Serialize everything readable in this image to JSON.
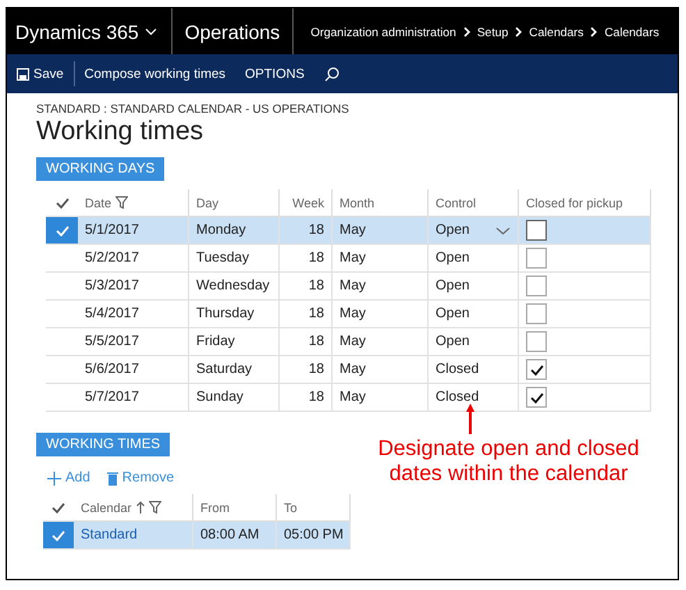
{
  "top_bar": {
    "product": "Dynamics 365",
    "module": "Operations",
    "breadcrumb": [
      "Organization administration",
      "Setup",
      "Calendars",
      "Calendars"
    ]
  },
  "toolbar": {
    "save": "Save",
    "actions": [
      "Compose working times",
      "OPTIONS"
    ]
  },
  "page": {
    "subtitle": "STANDARD : STANDARD CALENDAR - US OPERATIONS",
    "title": "Working times"
  },
  "working_days": {
    "tab": "WORKING DAYS",
    "columns": [
      "Date",
      "Day",
      "Week",
      "Month",
      "Control",
      "Closed for pickup"
    ],
    "rows": [
      {
        "date": "5/1/2017",
        "day": "Monday",
        "week": "18",
        "month": "May",
        "control": "Open",
        "closed_for_pickup": false,
        "selected": true
      },
      {
        "date": "5/2/2017",
        "day": "Tuesday",
        "week": "18",
        "month": "May",
        "control": "Open",
        "closed_for_pickup": false,
        "selected": false
      },
      {
        "date": "5/3/2017",
        "day": "Wednesday",
        "week": "18",
        "month": "May",
        "control": "Open",
        "closed_for_pickup": false,
        "selected": false
      },
      {
        "date": "5/4/2017",
        "day": "Thursday",
        "week": "18",
        "month": "May",
        "control": "Open",
        "closed_for_pickup": false,
        "selected": false
      },
      {
        "date": "5/5/2017",
        "day": "Friday",
        "week": "18",
        "month": "May",
        "control": "Open",
        "closed_for_pickup": false,
        "selected": false
      },
      {
        "date": "5/6/2017",
        "day": "Saturday",
        "week": "18",
        "month": "May",
        "control": "Closed",
        "closed_for_pickup": true,
        "selected": false
      },
      {
        "date": "5/7/2017",
        "day": "Sunday",
        "week": "18",
        "month": "May",
        "control": "Closed",
        "closed_for_pickup": true,
        "selected": false
      }
    ]
  },
  "working_times": {
    "tab": "WORKING TIMES",
    "add": "Add",
    "remove": "Remove",
    "columns": [
      "Calendar",
      "From",
      "To"
    ],
    "rows": [
      {
        "calendar": "Standard",
        "from": "08:00 AM",
        "to": "05:00 PM",
        "selected": true
      }
    ]
  },
  "annotation": "Designate open and closed dates within the calendar"
}
